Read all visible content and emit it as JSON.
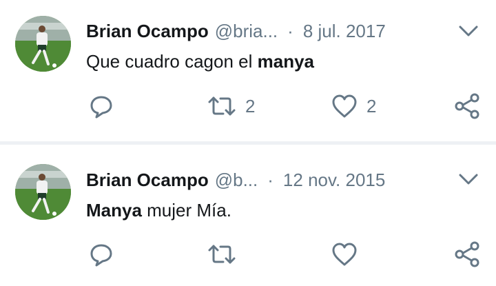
{
  "tweets": [
    {
      "name": "Brian Ocampo",
      "handle": "@bria...",
      "separator": "·",
      "date": "8 jul. 2017",
      "text_before": "Que cuadro cagon el ",
      "text_bold": "manya",
      "text_after": "",
      "retweets": "2",
      "likes": "2",
      "icons": [
        "reply-icon",
        "retweet-icon",
        "like-icon",
        "share-icon",
        "chevron-down-icon"
      ]
    },
    {
      "name": "Brian Ocampo",
      "handle": "@b...",
      "separator": "·",
      "date": "12 nov. 2015",
      "text_before": "",
      "text_bold": "Manya",
      "text_after": " mujer Mía.",
      "retweets": "",
      "likes": "",
      "icons": [
        "reply-icon",
        "retweet-icon",
        "like-icon",
        "share-icon",
        "chevron-down-icon"
      ]
    }
  ],
  "colors": {
    "text": "#14171a",
    "secondary": "#657786",
    "divider": "#eef1f4"
  }
}
